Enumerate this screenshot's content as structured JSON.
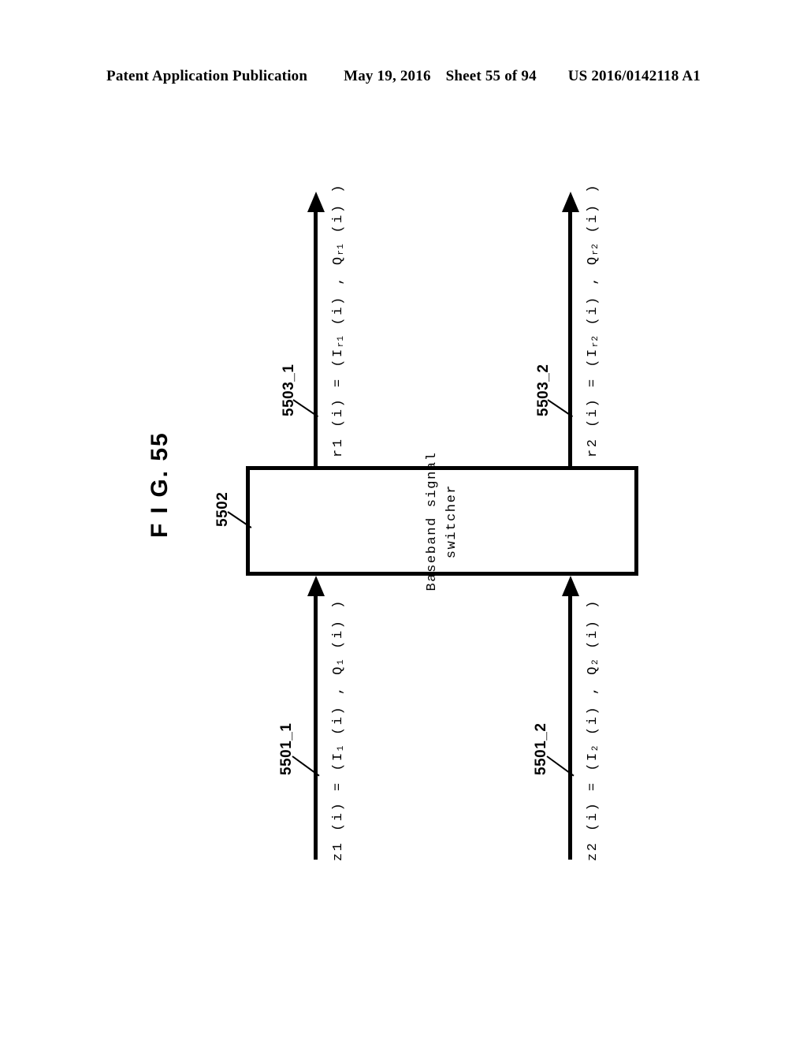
{
  "header": {
    "publication": "Patent Application Publication",
    "date": "May 19, 2016",
    "sheet": "Sheet 55 of 94",
    "patent_number": "US 2016/0142118 A1"
  },
  "figure": {
    "label": "F I G. 55"
  },
  "block": {
    "ref": "5502",
    "label_line1": "Baseband signal",
    "label_line2": "switcher"
  },
  "signals": {
    "output_1": {
      "ref": "5503_1",
      "base": "r1 (i) = (I",
      "sub1": "r1",
      "mid": " (i) , Q",
      "sub2": "r1",
      "tail": " (i) )"
    },
    "output_2": {
      "ref": "5503_2",
      "base": "r2 (i) = (I",
      "sub1": "r2",
      "mid": " (i) , Q",
      "sub2": "r2",
      "tail": " (i) )"
    },
    "input_1": {
      "ref": "5501_1",
      "base": "z1 (i) = (I",
      "sub1": "1",
      "mid": " (i) , Q",
      "sub2": "1",
      "tail": " (i) )"
    },
    "input_2": {
      "ref": "5501_2",
      "base": "z2 (i) = (I",
      "sub1": "2",
      "mid": " (i) , Q",
      "sub2": "2",
      "tail": " (i) )"
    }
  },
  "colors": {
    "ink": "#000000",
    "paper": "#ffffff"
  }
}
